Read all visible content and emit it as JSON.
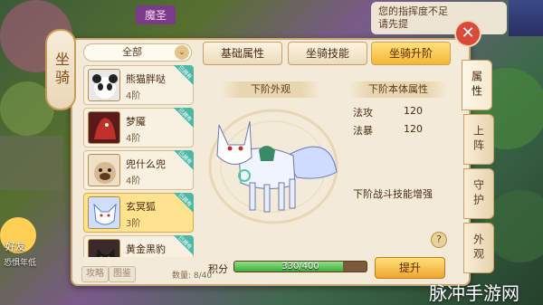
{
  "hud": {
    "player_name": "魔圣",
    "chat_line1": "您的指挥度不足",
    "chat_line2": "请先提",
    "friends_label": "好友",
    "side_tip": "恐惧年低"
  },
  "window": {
    "title": "坐骑",
    "close_symbol": "✕",
    "filter": {
      "selected": "全部",
      "arrow": "⌄"
    },
    "tabs": [
      {
        "label": "基础属性",
        "active": false
      },
      {
        "label": "坐骑技能",
        "active": false
      },
      {
        "label": "坐骑升阶",
        "active": true
      }
    ],
    "mounts": [
      {
        "name": "熊猫胖哒",
        "level": "4阶",
        "selected": false,
        "owned": "已拥有",
        "color": "#e8e8e8"
      },
      {
        "name": "梦魇",
        "level": "4阶",
        "selected": false,
        "owned": "已拥有",
        "color": "#b8302a"
      },
      {
        "name": "兜什么兜",
        "level": "4阶",
        "selected": false,
        "owned": "已拥有",
        "color": "#d8b890"
      },
      {
        "name": "玄冥狐",
        "level": "3阶",
        "selected": true,
        "owned": "已拥有",
        "color": "#5a7ad0"
      },
      {
        "name": "黄金黑豹",
        "level": "",
        "selected": false,
        "owned": "已拥有",
        "color": "#6a3a2a"
      }
    ],
    "footer": {
      "btn_strategy": "攻略",
      "btn_gallery": "图鉴",
      "count": "数量: 8/40"
    },
    "next_appearance_title": "下阶外观",
    "next_attr_title": "下阶本体属性",
    "stats": [
      {
        "name": "法攻",
        "value": "120"
      },
      {
        "name": "法暴",
        "value": "120"
      }
    ],
    "next_skill": "下阶战斗技能增强",
    "help": "?",
    "points_label": "积分",
    "points_text": "330/400",
    "points_fraction": 0.825,
    "upgrade_label": "提升",
    "side_tabs": [
      {
        "label": "属性",
        "active": true
      },
      {
        "label": "上阵",
        "active": false
      },
      {
        "label": "守护",
        "active": false
      },
      {
        "label": "外观",
        "active": false
      }
    ]
  },
  "watermark": "脉冲手游网"
}
